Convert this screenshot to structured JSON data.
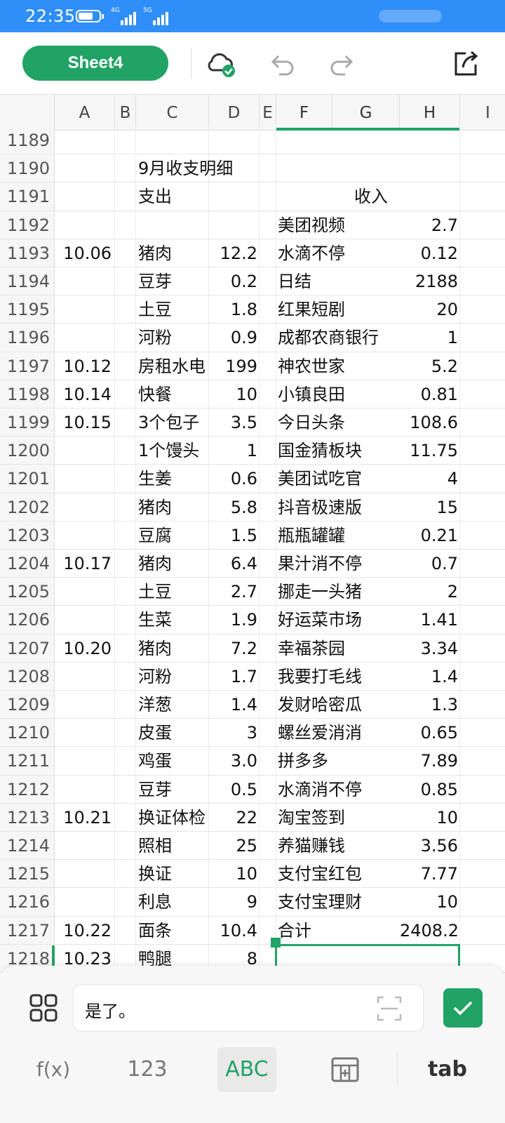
{
  "statusbar": {
    "time": "22:35",
    "sig1_label": "4G",
    "sig2_label": "5G"
  },
  "toolbar": {
    "sheet_name": "Sheet4"
  },
  "columns": [
    "A",
    "B",
    "C",
    "D",
    "E",
    "F",
    "G",
    "H",
    "I"
  ],
  "rows": [
    {
      "n": "1189",
      "a": "",
      "c": "",
      "d": "",
      "f": "",
      "h": ""
    },
    {
      "n": "1190",
      "a": "",
      "c": "9月收支明细",
      "d": "",
      "f": "",
      "h": ""
    },
    {
      "n": "1191",
      "a": "",
      "c": "支出",
      "d": "",
      "f": "",
      "g": "收入",
      "h": ""
    },
    {
      "n": "1192",
      "a": "",
      "c": "",
      "d": "",
      "f": "美团视频",
      "h": "2.7"
    },
    {
      "n": "1193",
      "a": "10.06",
      "c": "猪肉",
      "d": "12.2",
      "f": "水滴不停",
      "h": "0.12"
    },
    {
      "n": "1194",
      "a": "",
      "c": "豆芽",
      "d": "0.2",
      "f": "日结",
      "h": "2188"
    },
    {
      "n": "1195",
      "a": "",
      "c": "土豆",
      "d": "1.8",
      "f": "红果短剧",
      "h": "20"
    },
    {
      "n": "1196",
      "a": "",
      "c": "河粉",
      "d": "0.9",
      "f": "成都农商银行",
      "h": "1"
    },
    {
      "n": "1197",
      "a": "10.12",
      "c": "房租水电",
      "d": "199",
      "f": "神农世家",
      "h": "5.2"
    },
    {
      "n": "1198",
      "a": "10.14",
      "c": "快餐",
      "d": "10",
      "f": "小镇良田",
      "h": "0.81"
    },
    {
      "n": "1199",
      "a": "10.15",
      "c": "3个包子",
      "d": "3.5",
      "f": "今日头条",
      "h": "108.6"
    },
    {
      "n": "1200",
      "a": "",
      "c": "1个馒头",
      "d": "1",
      "f": "国金猜板块",
      "h": "11.75"
    },
    {
      "n": "1201",
      "a": "",
      "c": "生姜",
      "d": "0.6",
      "f": "美团试吃官",
      "h": "4"
    },
    {
      "n": "1202",
      "a": "",
      "c": "猪肉",
      "d": "5.8",
      "f": "抖音极速版",
      "h": "15"
    },
    {
      "n": "1203",
      "a": "",
      "c": "豆腐",
      "d": "1.5",
      "f": "瓶瓶罐罐",
      "h": "0.21"
    },
    {
      "n": "1204",
      "a": "10.17",
      "c": "猪肉",
      "d": "6.4",
      "f": "果汁消不停",
      "h": "0.7"
    },
    {
      "n": "1205",
      "a": "",
      "c": "土豆",
      "d": "2.7",
      "f": "挪走一头猪",
      "h": "2"
    },
    {
      "n": "1206",
      "a": "",
      "c": "生菜",
      "d": "1.9",
      "f": "好运菜市场",
      "h": "1.41"
    },
    {
      "n": "1207",
      "a": "10.20",
      "c": "猪肉",
      "d": "7.2",
      "f": "幸福茶园",
      "h": "3.34"
    },
    {
      "n": "1208",
      "a": "",
      "c": "河粉",
      "d": "1.7",
      "f": "我要打毛线",
      "h": "1.4"
    },
    {
      "n": "1209",
      "a": "",
      "c": "洋葱",
      "d": "1.4",
      "f": "发财哈密瓜",
      "h": "1.3"
    },
    {
      "n": "1210",
      "a": "",
      "c": "皮蛋",
      "d": "3",
      "f": "螺丝爱消消",
      "h": "0.65"
    },
    {
      "n": "1211",
      "a": "",
      "c": "鸡蛋",
      "d": "3.0",
      "f": "拼多多",
      "h": "7.89"
    },
    {
      "n": "1212",
      "a": "",
      "c": "豆芽",
      "d": "0.5",
      "f": "水滴消不停",
      "h": "0.85"
    },
    {
      "n": "1213",
      "a": "10.21",
      "c": "换证体检",
      "d": "22",
      "f": "淘宝签到",
      "h": "10"
    },
    {
      "n": "1214",
      "a": "",
      "c": "照相",
      "d": "25",
      "f": "养猫赚钱",
      "h": "3.56"
    },
    {
      "n": "1215",
      "a": "",
      "c": "换证",
      "d": "10",
      "f": "支付宝红包",
      "h": "7.77"
    },
    {
      "n": "1216",
      "a": "",
      "c": "利息",
      "d": "9",
      "f": "支付宝理财",
      "h": "10"
    },
    {
      "n": "1217",
      "a": "10.22",
      "c": "面条",
      "d": "10.4",
      "f": "合计",
      "h": "2408.2"
    },
    {
      "n": "1218",
      "a": "10.23",
      "c": "鸭腿",
      "d": "8",
      "f": "",
      "h": ""
    }
  ],
  "input_panel": {
    "cell_text": "是了。"
  },
  "keyboard": {
    "fx": "f(x)",
    "num": "123",
    "abc": "ABC",
    "tab": "tab"
  },
  "colors": {
    "accent": "#21a366",
    "statusbar": "#2f8ef7"
  }
}
